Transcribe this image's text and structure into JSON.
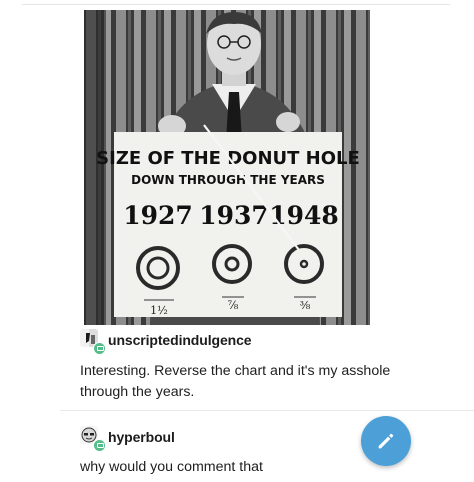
{
  "photo": {
    "sign": {
      "title": "SIZE OF THE DONUT HOLE",
      "subtitle": "DOWN THROUGH THE YEARS",
      "years": [
        "1927",
        "1937",
        "1948"
      ],
      "sizes": [
        "1½",
        "⅞",
        "⅜"
      ]
    }
  },
  "posts": [
    {
      "username": "unscriptedindulgence",
      "comment_line1": "Interesting. Reverse the chart and it's my asshole",
      "comment_line2": "through the years."
    },
    {
      "username": "hyperboul",
      "comment_line1": "why would you comment that"
    }
  ],
  "fab": {
    "icon": "pencil-icon",
    "color": "#4d9fd8"
  },
  "colors": {
    "reblog_badge": "#56bc8a",
    "text": "#1e1e1e"
  }
}
